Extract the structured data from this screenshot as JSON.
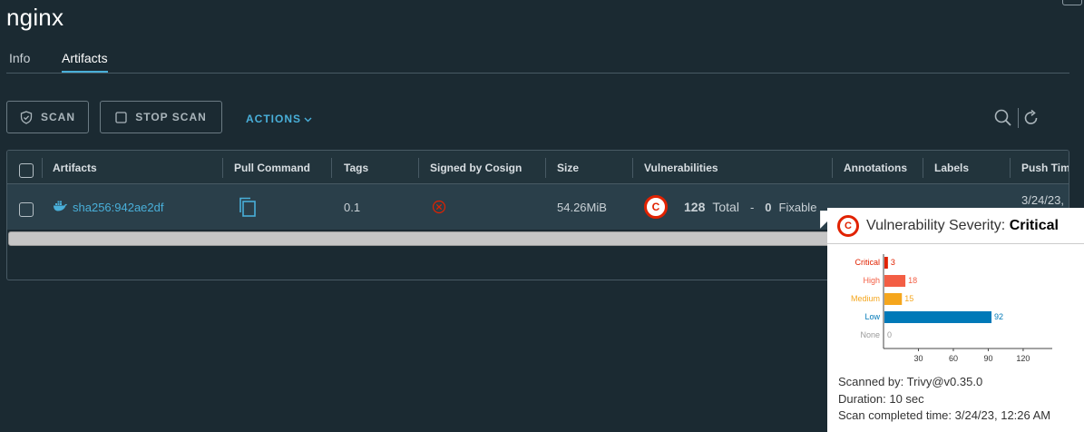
{
  "page": {
    "title": "nginx"
  },
  "tabs": [
    {
      "label": "Info"
    },
    {
      "label": "Artifacts"
    }
  ],
  "toolbar": {
    "scan_label": "SCAN",
    "stop_scan_label": "STOP SCAN",
    "actions_label": "ACTIONS"
  },
  "grid": {
    "columns": [
      "Artifacts",
      "Pull Command",
      "Tags",
      "Signed by Cosign",
      "Size",
      "Vulnerabilities",
      "Annotations",
      "Labels",
      "Push Time"
    ],
    "rows": [
      {
        "digest": "sha256:942ae2df",
        "tag": "0.1",
        "size": "54.26MiB",
        "vuln_badge": "C",
        "vuln_total": "128",
        "vuln_total_label": "Total",
        "vuln_fixable": "0",
        "vuln_fixable_label": "Fixable",
        "push_time": "3/24/23,"
      }
    ]
  },
  "popover": {
    "badge": "C",
    "title_prefix": "Vulnerability Severity:",
    "title_severity": "Critical",
    "scanned_by": "Scanned by: Trivy@v0.35.0",
    "duration": "Duration: 10 sec",
    "completed": "Scan completed time: 3/24/23, 12:26 AM"
  },
  "chart_data": {
    "type": "bar",
    "orientation": "horizontal",
    "categories": [
      "Critical",
      "High",
      "Medium",
      "Low",
      "None"
    ],
    "values": [
      3,
      18,
      15,
      92,
      0
    ],
    "colors": [
      "#e12200",
      "#f35e44",
      "#f5a61d",
      "#0079b8",
      "#999999"
    ],
    "xticks": [
      30,
      60,
      90,
      120
    ],
    "xlim": [
      0,
      145
    ]
  },
  "colors": {
    "background": "#1b2a32",
    "accent": "#49afd9",
    "critical": "#e12200"
  }
}
